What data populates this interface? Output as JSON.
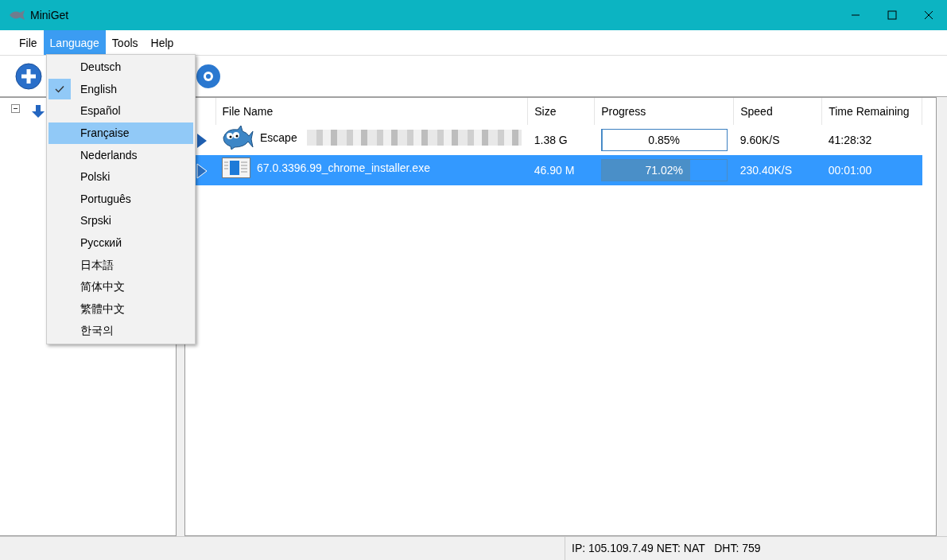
{
  "window": {
    "title": "MiniGet"
  },
  "menu_bar": [
    {
      "label": "File",
      "selected": false
    },
    {
      "label": "Language",
      "selected": true
    },
    {
      "label": "Tools",
      "selected": false
    },
    {
      "label": "Help",
      "selected": false
    }
  ],
  "language_menu": [
    {
      "label": "Deutsch",
      "checked": false,
      "selected": false
    },
    {
      "label": "English",
      "checked": true,
      "selected": false
    },
    {
      "label": "Español",
      "checked": false,
      "selected": false
    },
    {
      "label": "Française",
      "checked": false,
      "selected": true
    },
    {
      "label": "Nederlands",
      "checked": false,
      "selected": false
    },
    {
      "label": "Polski",
      "checked": false,
      "selected": false
    },
    {
      "label": "Português",
      "checked": false,
      "selected": false
    },
    {
      "label": "Srpski",
      "checked": false,
      "selected": false
    },
    {
      "label": "Русский",
      "checked": false,
      "selected": false
    },
    {
      "label": "日本語",
      "checked": false,
      "selected": false
    },
    {
      "label": "简体中文",
      "checked": false,
      "selected": false
    },
    {
      "label": "繁體中文",
      "checked": false,
      "selected": false
    },
    {
      "label": "한국의",
      "checked": false,
      "selected": false
    }
  ],
  "table": {
    "columns": [
      "File Name",
      "Size",
      "Progress",
      "Speed",
      "Time Remaining"
    ],
    "rows": [
      {
        "kind": "fish",
        "name": "Escape",
        "name_blurred": true,
        "size": "1.38 G",
        "progress": {
          "level": 0.0085,
          "reading": "0.85%"
        },
        "speed": "9.60K/S",
        "time_remaining": "41:28:32",
        "selected": false
      },
      {
        "kind": "installer",
        "name": "67.0.3396.99_chrome_installer.exe",
        "name_blurred": false,
        "size": "46.90 M",
        "progress": {
          "level": 0.7102,
          "reading": "71.02%"
        },
        "speed": "230.40K/S",
        "time_remaining": "00:01:00",
        "selected": true
      }
    ]
  },
  "status_bar": {
    "text": "IP: 105.109.7.49 NET: NAT   DHT: 759"
  }
}
